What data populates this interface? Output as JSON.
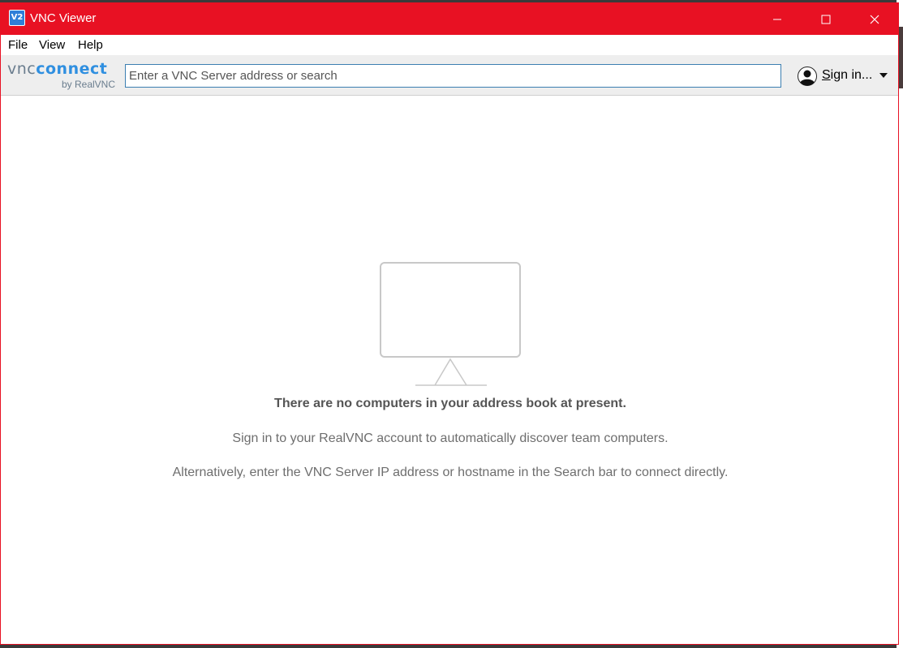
{
  "window": {
    "title": "VNC Viewer",
    "app_icon_text": "V2",
    "accent_color": "#e81123"
  },
  "menu": {
    "items": [
      {
        "label": "File"
      },
      {
        "label": "View"
      },
      {
        "label": "Help"
      }
    ]
  },
  "toolbar": {
    "logo": {
      "vnc": "vnc",
      "connect": "connect",
      "by": "by RealVNC"
    },
    "search": {
      "value": "",
      "placeholder": "Enter a VNC Server address or search"
    },
    "signin_label": "Sign in..."
  },
  "empty_state": {
    "icon": "monitor-icon",
    "headline": "There are no computers in your address book at present.",
    "line1": "Sign in to your RealVNC account to automatically discover team computers.",
    "line2": "Alternatively, enter the VNC Server IP address or hostname in the Search bar to connect directly."
  }
}
